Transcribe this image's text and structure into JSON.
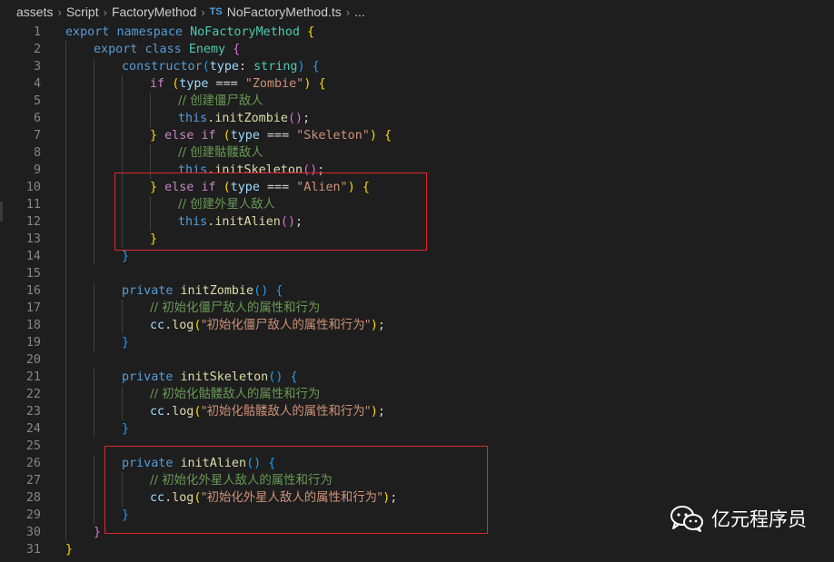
{
  "breadcrumb": {
    "segments": [
      "assets",
      "Script",
      "FactoryMethod"
    ],
    "file_icon": "TS",
    "file": "NoFactoryMethod.ts",
    "more": "..."
  },
  "editor": {
    "lines": [
      {
        "n": "1",
        "indent": 0,
        "tokens": [
          {
            "t": "export ",
            "c": "kw"
          },
          {
            "t": "namespace ",
            "c": "kw"
          },
          {
            "t": "NoFactoryMethod",
            "c": "cls"
          },
          {
            "t": " "
          },
          {
            "t": "{",
            "c": "b1"
          }
        ]
      },
      {
        "n": "2",
        "indent": 1,
        "tokens": [
          {
            "t": "export ",
            "c": "kw"
          },
          {
            "t": "class ",
            "c": "kw"
          },
          {
            "t": "Enemy",
            "c": "cls"
          },
          {
            "t": " "
          },
          {
            "t": "{",
            "c": "b2"
          }
        ]
      },
      {
        "n": "3",
        "indent": 2,
        "tokens": [
          {
            "t": "constructor",
            "c": "kw"
          },
          {
            "t": "(",
            "c": "b3"
          },
          {
            "t": "type",
            "c": "var"
          },
          {
            "t": ": "
          },
          {
            "t": "string",
            "c": "cls"
          },
          {
            "t": ")",
            "c": "b3"
          },
          {
            "t": " "
          },
          {
            "t": "{",
            "c": "b3"
          }
        ]
      },
      {
        "n": "4",
        "indent": 3,
        "tokens": [
          {
            "t": "if ",
            "c": "ctrl"
          },
          {
            "t": "(",
            "c": "b1"
          },
          {
            "t": "type",
            "c": "var"
          },
          {
            "t": " === "
          },
          {
            "t": "\"Zombie\"",
            "c": "str"
          },
          {
            "t": ")",
            "c": "b1"
          },
          {
            "t": " "
          },
          {
            "t": "{",
            "c": "b1"
          }
        ]
      },
      {
        "n": "5",
        "indent": 4,
        "tokens": [
          {
            "t": "// 创建僵尸敌人",
            "c": "cm"
          }
        ]
      },
      {
        "n": "6",
        "indent": 4,
        "tokens": [
          {
            "t": "this",
            "c": "kw"
          },
          {
            "t": "."
          },
          {
            "t": "initZombie",
            "c": "fn"
          },
          {
            "t": "(",
            "c": "b2"
          },
          {
            "t": ")",
            "c": "b2"
          },
          {
            "t": ";"
          }
        ]
      },
      {
        "n": "7",
        "indent": 3,
        "tokens": [
          {
            "t": "}",
            "c": "b1"
          },
          {
            "t": " "
          },
          {
            "t": "else ",
            "c": "ctrl"
          },
          {
            "t": "if ",
            "c": "ctrl"
          },
          {
            "t": "(",
            "c": "b1"
          },
          {
            "t": "type",
            "c": "var"
          },
          {
            "t": " === "
          },
          {
            "t": "\"Skeleton\"",
            "c": "str"
          },
          {
            "t": ")",
            "c": "b1"
          },
          {
            "t": " "
          },
          {
            "t": "{",
            "c": "b1"
          }
        ]
      },
      {
        "n": "8",
        "indent": 4,
        "tokens": [
          {
            "t": "// 创建骷髅敌人",
            "c": "cm"
          }
        ]
      },
      {
        "n": "9",
        "indent": 4,
        "tokens": [
          {
            "t": "this",
            "c": "kw"
          },
          {
            "t": "."
          },
          {
            "t": "initSkeleton",
            "c": "fn"
          },
          {
            "t": "(",
            "c": "b2"
          },
          {
            "t": ")",
            "c": "b2"
          },
          {
            "t": ";"
          }
        ]
      },
      {
        "n": "10",
        "indent": 3,
        "tokens": [
          {
            "t": "}",
            "c": "b1"
          },
          {
            "t": " "
          },
          {
            "t": "else ",
            "c": "ctrl"
          },
          {
            "t": "if ",
            "c": "ctrl"
          },
          {
            "t": "(",
            "c": "b1"
          },
          {
            "t": "type",
            "c": "var"
          },
          {
            "t": " === "
          },
          {
            "t": "\"Alien\"",
            "c": "str"
          },
          {
            "t": ")",
            "c": "b1"
          },
          {
            "t": " "
          },
          {
            "t": "{",
            "c": "b1"
          }
        ]
      },
      {
        "n": "11",
        "indent": 4,
        "tokens": [
          {
            "t": "// 创建外星人敌人",
            "c": "cm"
          }
        ]
      },
      {
        "n": "12",
        "indent": 4,
        "tokens": [
          {
            "t": "this",
            "c": "kw"
          },
          {
            "t": "."
          },
          {
            "t": "initAlien",
            "c": "fn"
          },
          {
            "t": "(",
            "c": "b2"
          },
          {
            "t": ")",
            "c": "b2"
          },
          {
            "t": ";"
          }
        ]
      },
      {
        "n": "13",
        "indent": 3,
        "tokens": [
          {
            "t": "}",
            "c": "b1"
          }
        ]
      },
      {
        "n": "14",
        "indent": 2,
        "tokens": [
          {
            "t": "}",
            "c": "b3"
          }
        ]
      },
      {
        "n": "15",
        "indent": 0,
        "tokens": []
      },
      {
        "n": "16",
        "indent": 2,
        "tokens": [
          {
            "t": "private ",
            "c": "kw"
          },
          {
            "t": "initZombie",
            "c": "fn"
          },
          {
            "t": "(",
            "c": "b3"
          },
          {
            "t": ")",
            "c": "b3"
          },
          {
            "t": " "
          },
          {
            "t": "{",
            "c": "b3"
          }
        ]
      },
      {
        "n": "17",
        "indent": 3,
        "tokens": [
          {
            "t": "// 初始化僵尸敌人的属性和行为",
            "c": "cm"
          }
        ]
      },
      {
        "n": "18",
        "indent": 3,
        "tokens": [
          {
            "t": "cc",
            "c": "var"
          },
          {
            "t": "."
          },
          {
            "t": "log",
            "c": "fn"
          },
          {
            "t": "(",
            "c": "b1"
          },
          {
            "t": "\"初始化僵尸敌人的属性和行为\"",
            "c": "str"
          },
          {
            "t": ")",
            "c": "b1"
          },
          {
            "t": ";"
          }
        ]
      },
      {
        "n": "19",
        "indent": 2,
        "tokens": [
          {
            "t": "}",
            "c": "b3"
          }
        ]
      },
      {
        "n": "20",
        "indent": 0,
        "tokens": []
      },
      {
        "n": "21",
        "indent": 2,
        "tokens": [
          {
            "t": "private ",
            "c": "kw"
          },
          {
            "t": "initSkeleton",
            "c": "fn"
          },
          {
            "t": "(",
            "c": "b3"
          },
          {
            "t": ")",
            "c": "b3"
          },
          {
            "t": " "
          },
          {
            "t": "{",
            "c": "b3"
          }
        ]
      },
      {
        "n": "22",
        "indent": 3,
        "tokens": [
          {
            "t": "// 初始化骷髅敌人的属性和行为",
            "c": "cm"
          }
        ]
      },
      {
        "n": "23",
        "indent": 3,
        "tokens": [
          {
            "t": "cc",
            "c": "var"
          },
          {
            "t": "."
          },
          {
            "t": "log",
            "c": "fn"
          },
          {
            "t": "(",
            "c": "b1"
          },
          {
            "t": "\"初始化骷髅敌人的属性和行为\"",
            "c": "str"
          },
          {
            "t": ")",
            "c": "b1"
          },
          {
            "t": ";"
          }
        ]
      },
      {
        "n": "24",
        "indent": 2,
        "tokens": [
          {
            "t": "}",
            "c": "b3"
          }
        ]
      },
      {
        "n": "25",
        "indent": 0,
        "tokens": []
      },
      {
        "n": "26",
        "indent": 2,
        "tokens": [
          {
            "t": "private ",
            "c": "kw"
          },
          {
            "t": "initAlien",
            "c": "fn"
          },
          {
            "t": "(",
            "c": "b3"
          },
          {
            "t": ")",
            "c": "b3"
          },
          {
            "t": " "
          },
          {
            "t": "{",
            "c": "b3"
          }
        ]
      },
      {
        "n": "27",
        "indent": 3,
        "tokens": [
          {
            "t": "// 初始化外星人敌人的属性和行为",
            "c": "cm"
          }
        ]
      },
      {
        "n": "28",
        "indent": 3,
        "tokens": [
          {
            "t": "cc",
            "c": "var"
          },
          {
            "t": "."
          },
          {
            "t": "log",
            "c": "fn"
          },
          {
            "t": "(",
            "c": "b1"
          },
          {
            "t": "\"初始化外星人敌人的属性和行为\"",
            "c": "str"
          },
          {
            "t": ")",
            "c": "b1"
          },
          {
            "t": ";"
          }
        ]
      },
      {
        "n": "29",
        "indent": 2,
        "tokens": [
          {
            "t": "}",
            "c": "b3"
          }
        ]
      },
      {
        "n": "30",
        "indent": 1,
        "tokens": [
          {
            "t": "}",
            "c": "b2"
          }
        ]
      },
      {
        "n": "31",
        "indent": 0,
        "tokens": [
          {
            "t": "}",
            "c": "b1"
          }
        ]
      }
    ]
  },
  "watermark": {
    "icon": "wechat-icon",
    "text": "亿元程序员"
  },
  "colors": {
    "background": "#1e1e1e",
    "keyword": "#569cd6",
    "control": "#c586c0",
    "type": "#4ec9b0",
    "function": "#dcdcaa",
    "variable": "#9cdcfe",
    "string": "#ce9178",
    "comment": "#6a9955",
    "highlight_box": "#e0262c"
  }
}
